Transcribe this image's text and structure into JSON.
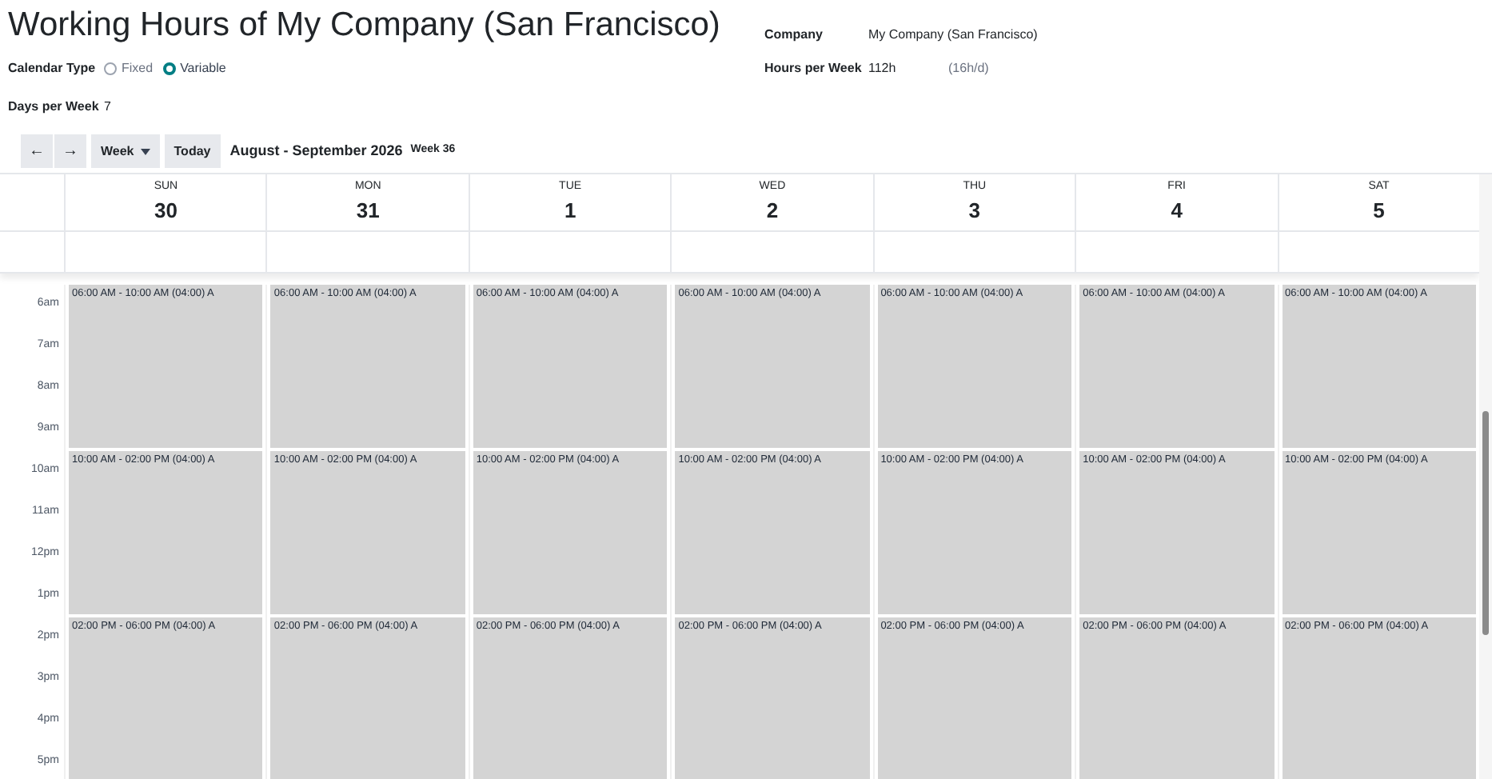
{
  "title": "Working Hours of My Company (San Francisco)",
  "calendar_type": {
    "label": "Calendar Type",
    "options": [
      {
        "label": "Fixed",
        "selected": false
      },
      {
        "label": "Variable",
        "selected": true
      }
    ]
  },
  "days_per_week": {
    "label": "Days per Week",
    "value": "7"
  },
  "company": {
    "label": "Company",
    "value": "My Company (San Francisco)"
  },
  "hours_per_week": {
    "label": "Hours per Week",
    "value": "112h",
    "note": "(16h/d)"
  },
  "toolbar": {
    "prev": "←",
    "next": "→",
    "view": "Week",
    "today": "Today",
    "range": "August - September 2026",
    "week": "Week 36"
  },
  "time_labels": [
    "6am",
    "7am",
    "8am",
    "9am",
    "10am",
    "11am",
    "12pm",
    "1pm",
    "2pm",
    "3pm",
    "4pm",
    "5pm"
  ],
  "days": [
    {
      "name": "SUN",
      "number": "30",
      "events": [
        "06:00 AM - 10:00 AM (04:00) A",
        "10:00 AM - 02:00 PM (04:00) A",
        "02:00 PM - 06:00 PM (04:00) A"
      ]
    },
    {
      "name": "MON",
      "number": "31",
      "events": [
        "06:00 AM - 10:00 AM (04:00) A",
        "10:00 AM - 02:00 PM (04:00) A",
        "02:00 PM - 06:00 PM (04:00) A"
      ]
    },
    {
      "name": "TUE",
      "number": "1",
      "events": [
        "06:00 AM - 10:00 AM (04:00) A",
        "10:00 AM - 02:00 PM (04:00) A",
        "02:00 PM - 06:00 PM (04:00) A"
      ]
    },
    {
      "name": "WED",
      "number": "2",
      "events": [
        "06:00 AM - 10:00 AM (04:00) A",
        "10:00 AM - 02:00 PM (04:00) A",
        "02:00 PM - 06:00 PM (04:00) A"
      ]
    },
    {
      "name": "THU",
      "number": "3",
      "events": [
        "06:00 AM - 10:00 AM (04:00) A",
        "10:00 AM - 02:00 PM (04:00) A",
        "02:00 PM - 06:00 PM (04:00) A"
      ]
    },
    {
      "name": "FRI",
      "number": "4",
      "events": [
        "06:00 AM - 10:00 AM (04:00) A",
        "10:00 AM - 02:00 PM (04:00) A",
        "02:00 PM - 06:00 PM (04:00) A"
      ]
    },
    {
      "name": "SAT",
      "number": "5",
      "events": [
        "06:00 AM - 10:00 AM (04:00) A",
        "10:00 AM - 02:00 PM (04:00) A",
        "02:00 PM - 06:00 PM (04:00) A"
      ]
    }
  ]
}
